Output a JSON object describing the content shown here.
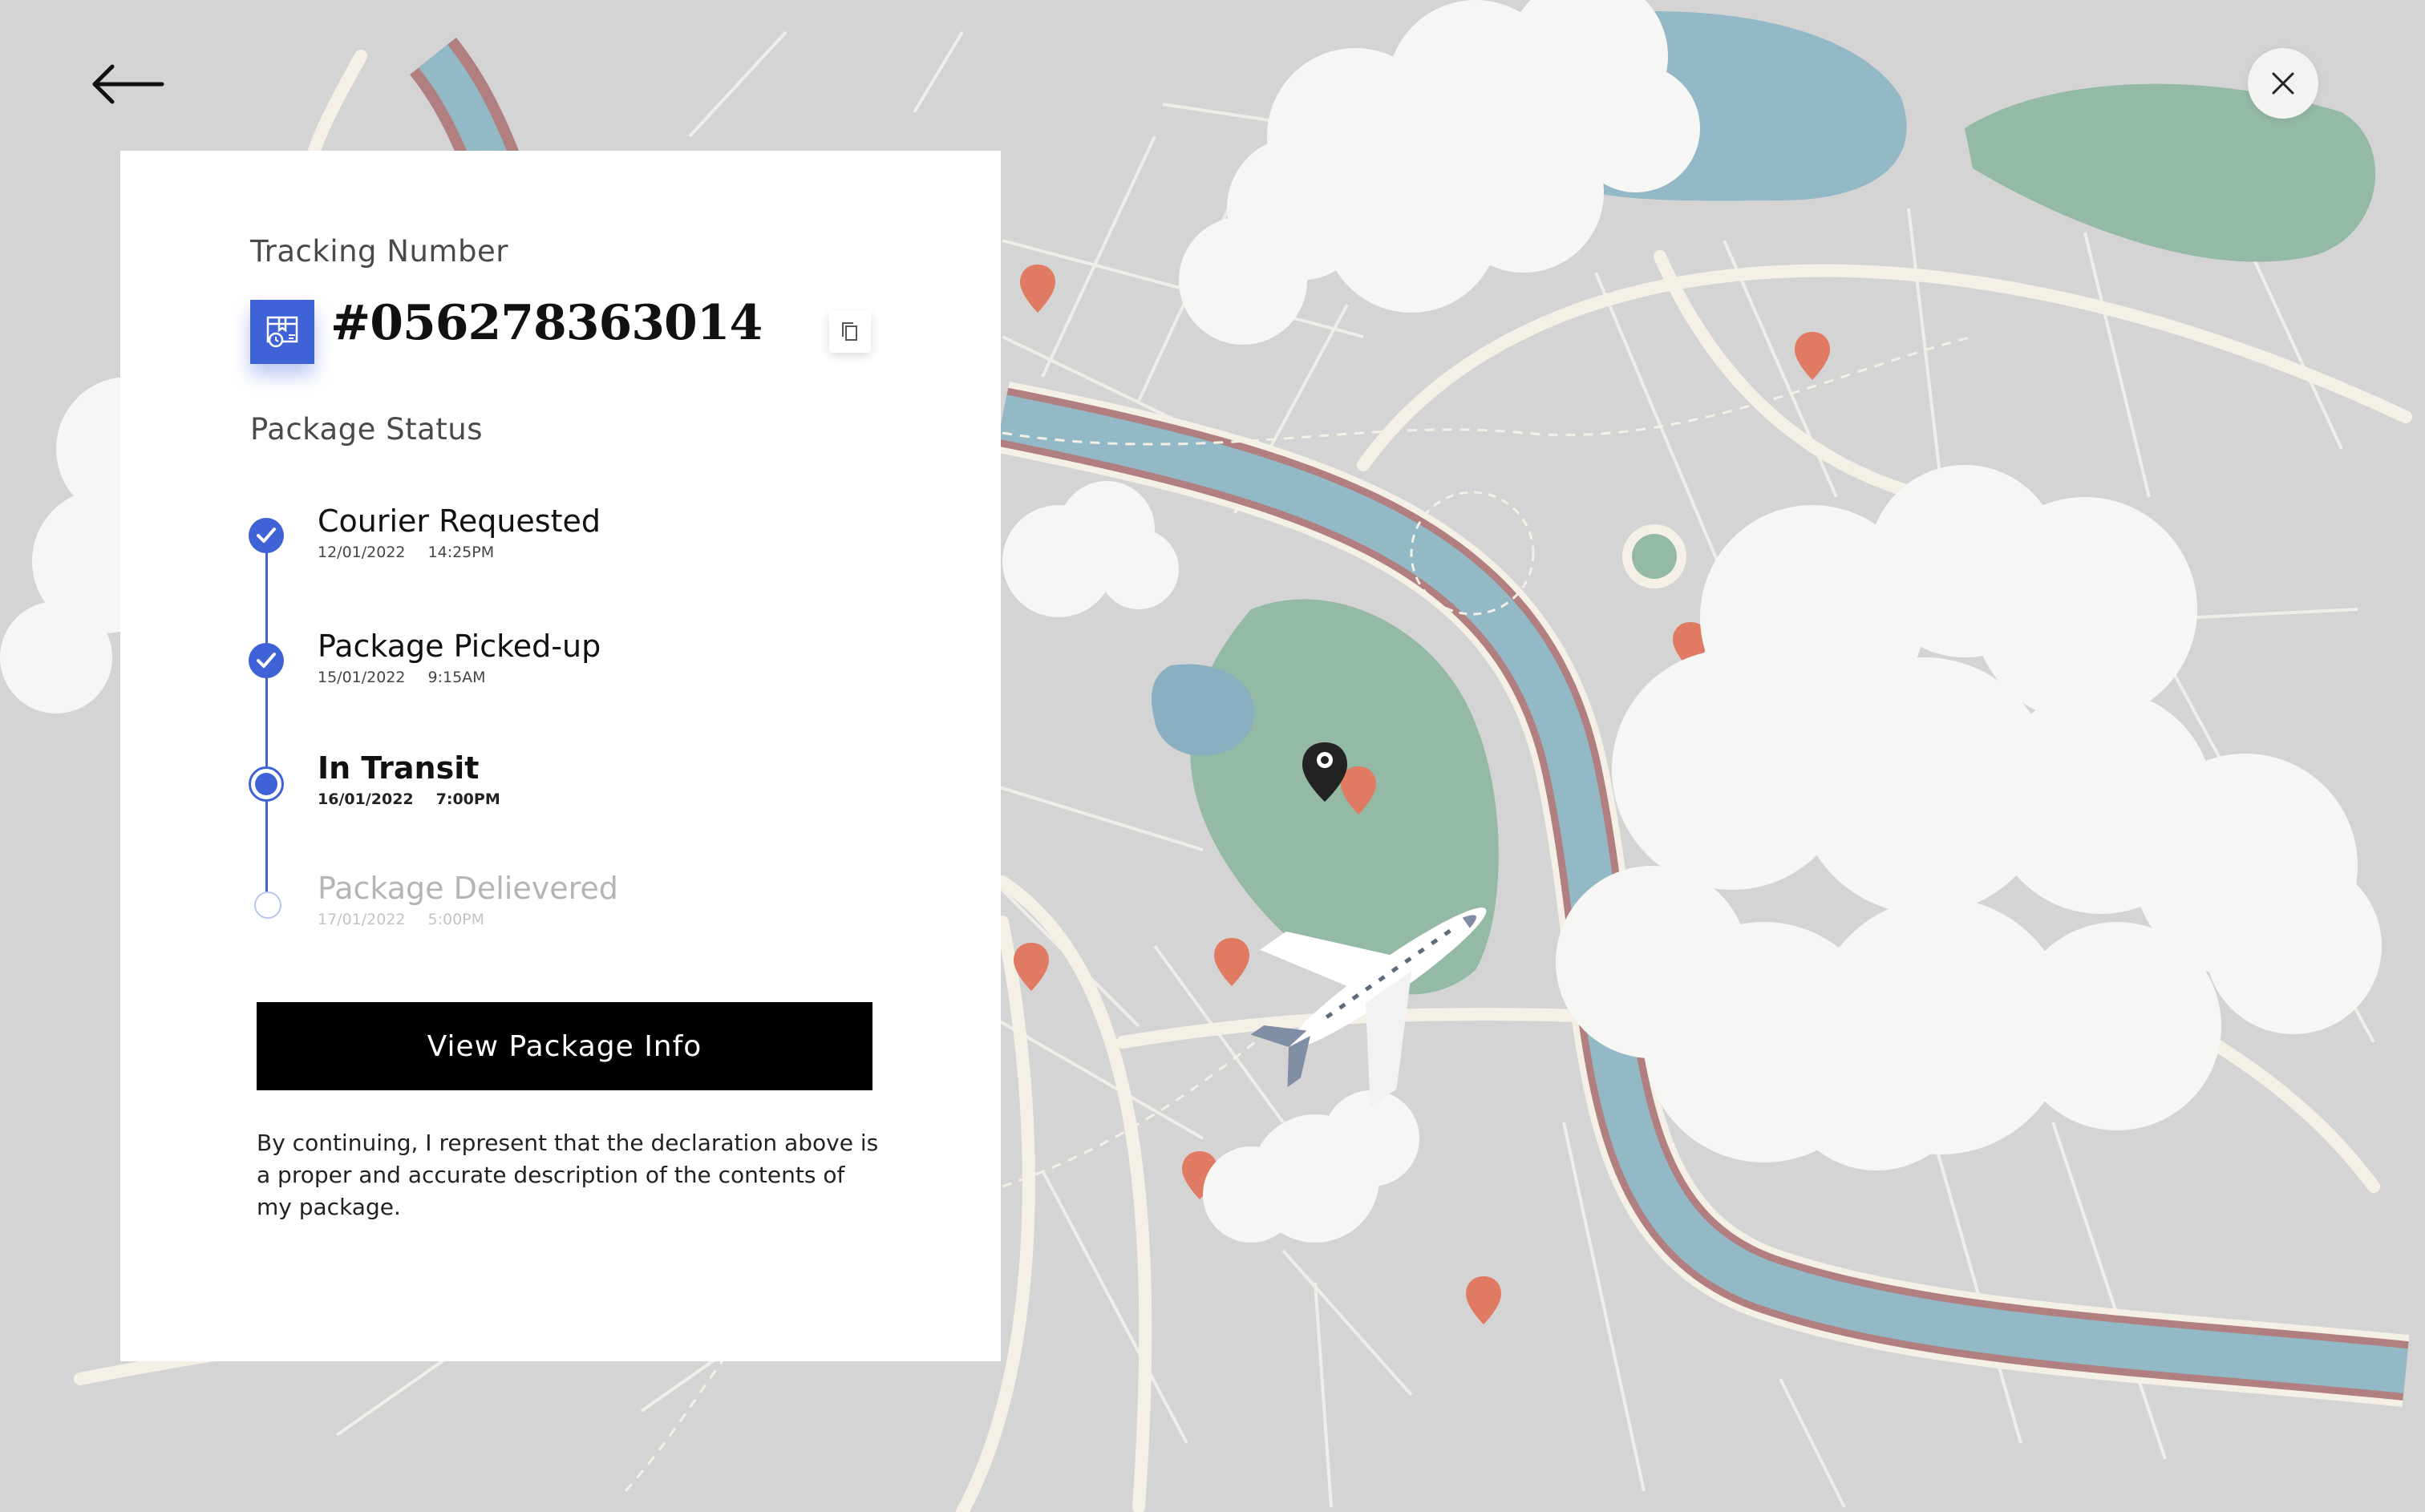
{
  "nav": {
    "back_icon": "arrow-left-icon",
    "close_icon": "close-icon"
  },
  "tracking": {
    "label": "Tracking Number",
    "number": "#056278363014",
    "badge_icon": "package-icon",
    "copy_icon": "copy-icon"
  },
  "status": {
    "label": "Package Status",
    "steps": [
      {
        "title": "Courier Requested",
        "date": "12/01/2022",
        "time": "14:25PM",
        "state": "done"
      },
      {
        "title": "Package Picked-up",
        "date": "15/01/2022",
        "time": "9:15AM",
        "state": "done"
      },
      {
        "title": "In Transit",
        "date": "16/01/2022",
        "time": "7:00PM",
        "state": "current"
      },
      {
        "title": "Package Delievered",
        "date": "17/01/2022",
        "time": "5:00PM",
        "state": "pending"
      }
    ]
  },
  "cta": {
    "label": "View Package Info"
  },
  "disclaimer": "By continuing, I represent that the declaration above is a proper and accurate description of the contents of my package.",
  "colors": {
    "accent": "#3f63d6",
    "map_bg": "#d4d4d4",
    "river": "#93b9c6",
    "park": "#94b9a5",
    "road": "#f4f0e6",
    "pin": "#e07a62"
  }
}
